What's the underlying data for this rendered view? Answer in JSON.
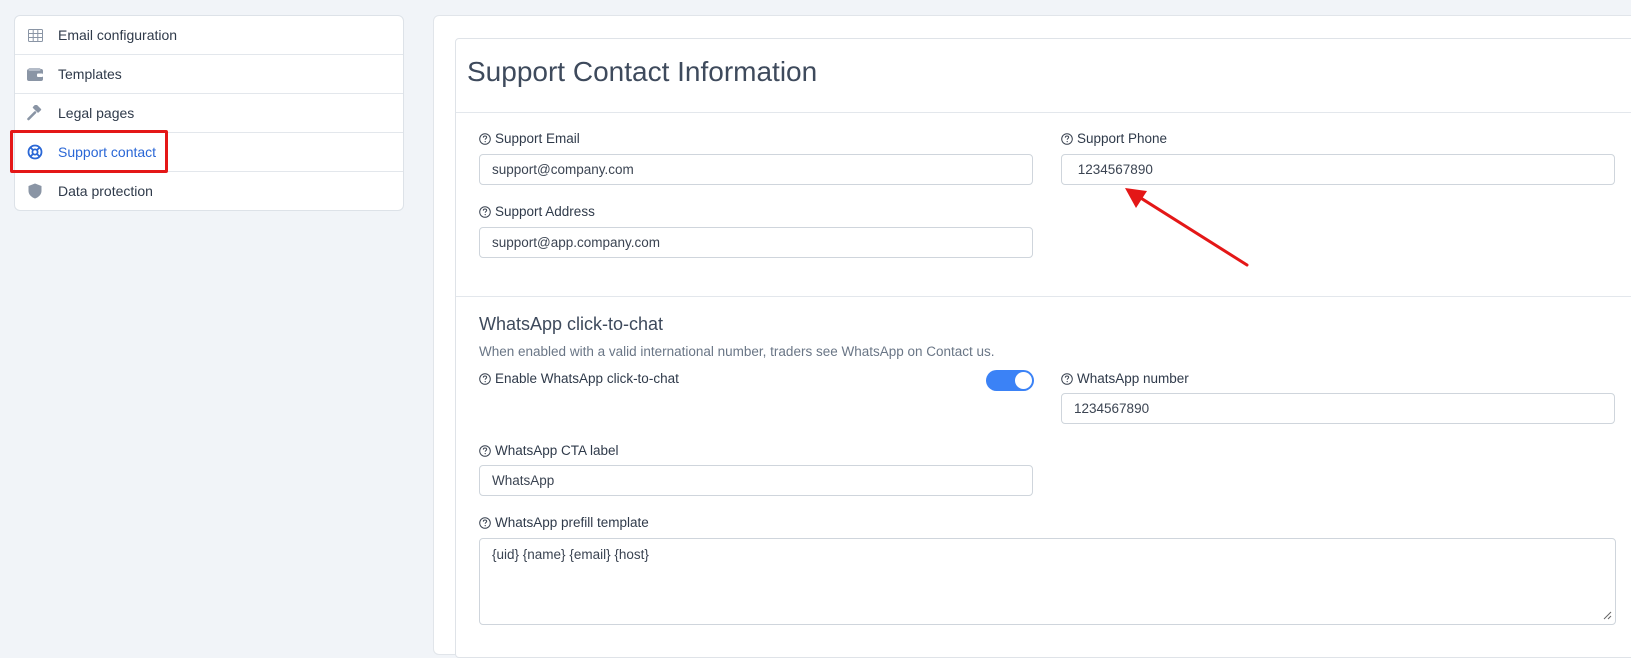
{
  "sidebar": {
    "items": [
      {
        "label": "Email configuration",
        "icon": "table-icon"
      },
      {
        "label": "Templates",
        "icon": "wallet-icon"
      },
      {
        "label": "Legal pages",
        "icon": "gavel-icon"
      },
      {
        "label": "Support contact",
        "icon": "lifebuoy-icon"
      },
      {
        "label": "Data protection",
        "icon": "shield-icon"
      }
    ],
    "active_index": 3
  },
  "main": {
    "title": "Support Contact Information",
    "support_email": {
      "label": "Support Email",
      "value": "support@company.com"
    },
    "support_phone": {
      "label": "Support Phone",
      "value": " 1234567890"
    },
    "support_address": {
      "label": "Support Address",
      "value": "support@app.company.com"
    },
    "whatsapp": {
      "title": "WhatsApp click-to-chat",
      "description": "When enabled with a valid international number, traders see WhatsApp on Contact us.",
      "enable": {
        "label": "Enable WhatsApp click-to-chat",
        "enabled": true
      },
      "number": {
        "label": "WhatsApp number",
        "value": "1234567890"
      },
      "cta": {
        "label": "WhatsApp CTA label",
        "value": "WhatsApp"
      },
      "prefill": {
        "label": "WhatsApp prefill template",
        "value": "{uid} {name} {email} {host}"
      }
    }
  },
  "colors": {
    "accent": "#3b82f6",
    "active_link": "#2a67d6",
    "annotation_red": "#e41717"
  }
}
